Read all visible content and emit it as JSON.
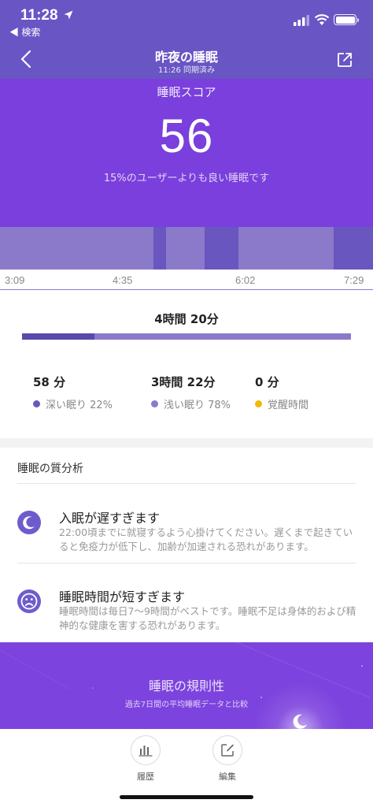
{
  "status_bar": {
    "time": "11:28",
    "back_app": "◀ 検索"
  },
  "nav": {
    "title": "昨夜の睡眠",
    "subtitle": "11:26 同期済み"
  },
  "score": {
    "label": "睡眠スコア",
    "value": "56",
    "description": "15%のユーザーよりも良い睡眠です"
  },
  "timeline": {
    "ticks": [
      "3:09",
      "4:35",
      "6:02",
      "7:29"
    ],
    "colors": {
      "light": "#8b79c9",
      "deep": "#6a56bf",
      "awake": "#f5b800"
    }
  },
  "summary": {
    "total": "4時間 20分",
    "deep_fraction": 0.22,
    "deep": {
      "value": "58 分",
      "label": "深い眠り 22%",
      "color": "#6a56bf"
    },
    "light": {
      "value": "3時間 22分",
      "label": "浅い眠り 78%",
      "color": "#8b79c9"
    },
    "awake": {
      "value": "0 分",
      "label": "覚醒時間",
      "color": "#f5b800"
    }
  },
  "analysis": {
    "title": "睡眠の質分析",
    "items": [
      {
        "icon": "moon-icon",
        "title": "入眠が遅すぎます",
        "description": "22:00頃までに就寝するよう心掛けてください。遅くまで起きていると免疫力が低下し、加齢が加速される恐れがあります。"
      },
      {
        "icon": "sad-face-icon",
        "title": "睡眠時間が短すぎます",
        "description": "睡眠時間は毎日7〜9時間がベストです。睡眠不足は身体的および精神的な健康を害する恐れがあります。"
      }
    ]
  },
  "regularity": {
    "title": "睡眠の規則性",
    "subtitle": "過去7日間の平均睡眠データと比較"
  },
  "tabs": [
    {
      "icon": "bar-chart-icon",
      "label": "履歴"
    },
    {
      "icon": "edit-icon",
      "label": "編集"
    }
  ]
}
